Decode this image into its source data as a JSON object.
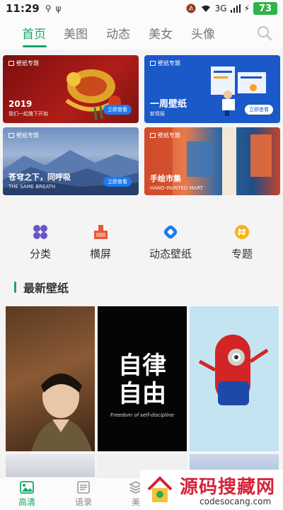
{
  "status_bar": {
    "time": "11:29",
    "signal_label": "3G",
    "battery": "73"
  },
  "top_nav": {
    "tabs": [
      "首页",
      "美图",
      "动态",
      "美女",
      "头像"
    ],
    "active_index": 0
  },
  "banners": [
    {
      "tag": "壁纸专题",
      "title": "2019",
      "subtitle": "我们一起撸下开始",
      "button": "立即查看"
    },
    {
      "tag": "壁纸专题",
      "title": "一周壁纸",
      "subtitle": "新情报",
      "button": "立即查看"
    },
    {
      "tag": "壁纸专题",
      "title": "苍穹之下，同呼吸",
      "subtitle": "THE SAME BREATH",
      "button": "立即查看"
    },
    {
      "tag": "壁纸专题",
      "title": "手绘市集",
      "subtitle": "HAND-PAINTED MART",
      "button": ""
    }
  ],
  "categories": [
    {
      "label": "分类",
      "icon": "grid-icon",
      "color": "#6a55c9"
    },
    {
      "label": "横屏",
      "icon": "landscape-icon",
      "color": "#e8573a"
    },
    {
      "label": "动态壁纸",
      "icon": "live-wallpaper-icon",
      "color": "#1d7af0"
    },
    {
      "label": "专题",
      "icon": "hashtag-icon",
      "color": "#f5b316"
    }
  ],
  "section": {
    "title": "最新壁纸"
  },
  "wallpapers": [
    {
      "kind": "portrait-photo"
    },
    {
      "kind": "text-art",
      "text_line1": "自律",
      "text_line2": "自由",
      "caption": "Freedom of self-discipline"
    },
    {
      "kind": "cartoon-minion"
    }
  ],
  "bottom_nav": {
    "items": [
      {
        "label": "高清",
        "icon": "image-icon"
      },
      {
        "label": "语录",
        "icon": "list-icon"
      },
      {
        "label": "美",
        "icon": "layers-icon"
      }
    ],
    "active_index": 0
  },
  "watermark": {
    "cn": "源码搜藏网",
    "en": "codesocang.com"
  },
  "colors": {
    "accent": "#17a86c"
  }
}
